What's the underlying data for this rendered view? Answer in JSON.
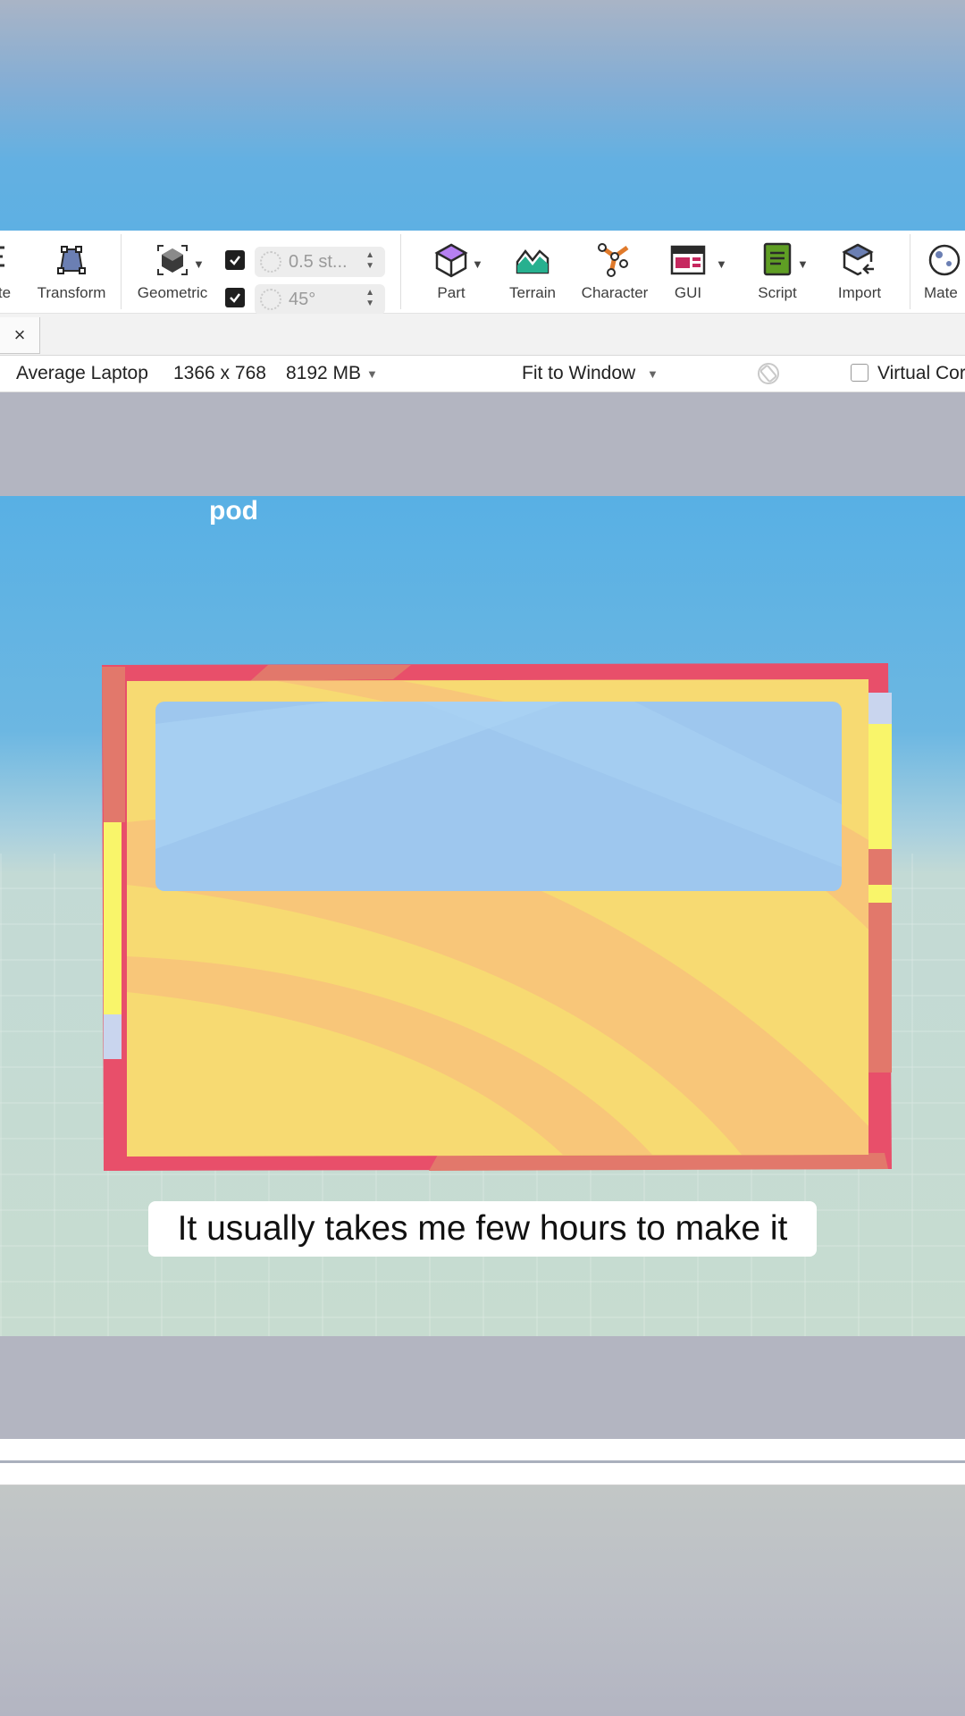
{
  "toolbar": {
    "left_partial_label": "te",
    "transform_label": "Transform",
    "geometric_label": "Geometric",
    "snap_move_value": "0.5 st...",
    "snap_rotate_value": "45°",
    "part_label": "Part",
    "terrain_label": "Terrain",
    "character_label": "Character",
    "gui_label": "GUI",
    "script_label": "Script",
    "import_label": "Import",
    "material_partial_label": "Mate"
  },
  "tabs": {
    "close_symbol": "×"
  },
  "device_bar": {
    "device": "Average Laptop",
    "resolution": "1366 x 768",
    "memory": "8192 MB",
    "scale": "Fit to Window",
    "virtual_label": "Virtual Cor"
  },
  "viewport": {
    "label": "pod",
    "subtitle": "It usually takes me few hours to make it"
  },
  "colors": {
    "frame_red": "#e84f6a",
    "frame_yellow": "#f7da72",
    "frame_orange": "#f8c679",
    "glass_blue": "#9ec7ee",
    "accent_purple": "#b680f2",
    "terrain_green": "#27b08f",
    "character_orange": "#e07a2b",
    "gui_pink": "#c6285f",
    "script_green": "#5f9e24"
  }
}
